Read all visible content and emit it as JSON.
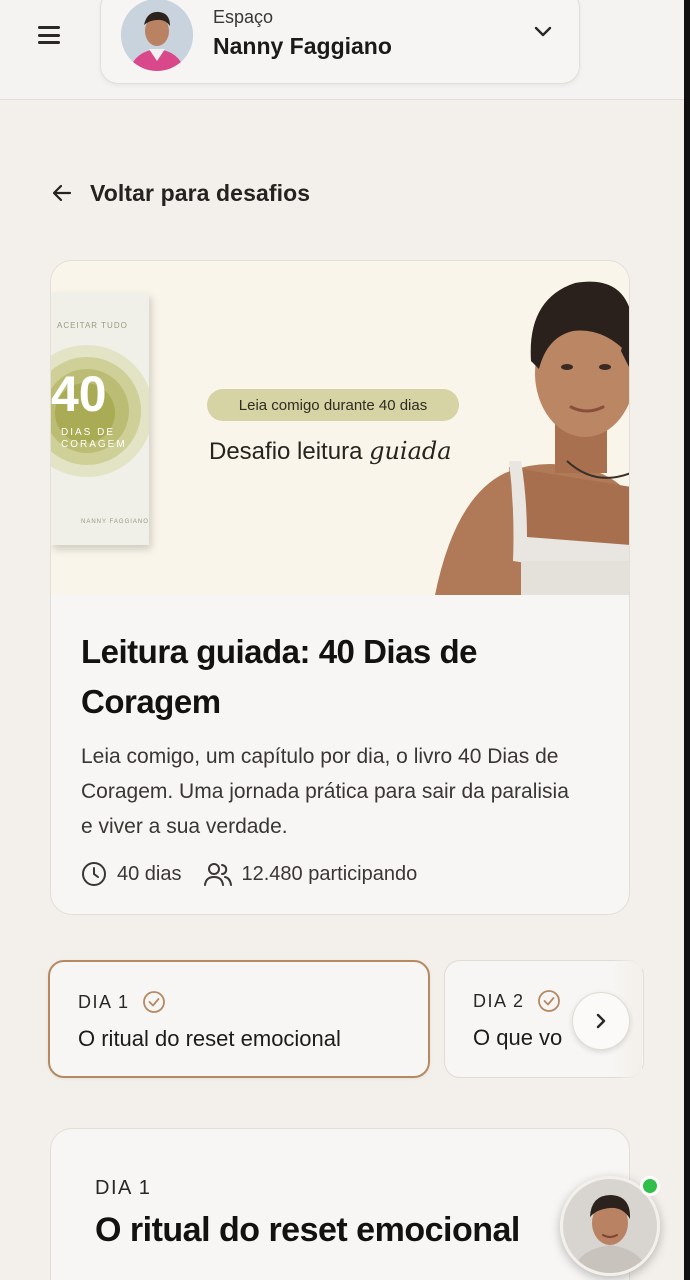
{
  "header": {
    "space_label": "Espaço",
    "space_name": "Nanny Faggiano"
  },
  "back_link": {
    "label": "Voltar para desafios"
  },
  "hero": {
    "banner_pill": "Leia comigo durante 40 dias",
    "banner_headline_plain": "Desafio leitura ",
    "banner_headline_script": "guiada",
    "book_number": "40",
    "title": "Leitura guiada: 40 Dias de Coragem",
    "description": "Leia comigo, um capítulo por dia, o livro 40 Dias de Coragem. Uma jornada prática para sair da paralisia e viver a sua verdade.",
    "duration": "40 dias",
    "participants": "12.480 participando"
  },
  "days": [
    {
      "label": "DIA 1",
      "title": "O ritual do reset emocional"
    },
    {
      "label": "DIA 2",
      "title": "O que vo"
    }
  ],
  "detail": {
    "day_label": "DIA 1",
    "title": "O ritual do reset emocional"
  },
  "colors": {
    "background": "#f3efea",
    "card": "#f7f6f4",
    "active_border": "#b58a63",
    "pill": "#d6d3a4",
    "online": "#2fbf4a"
  }
}
